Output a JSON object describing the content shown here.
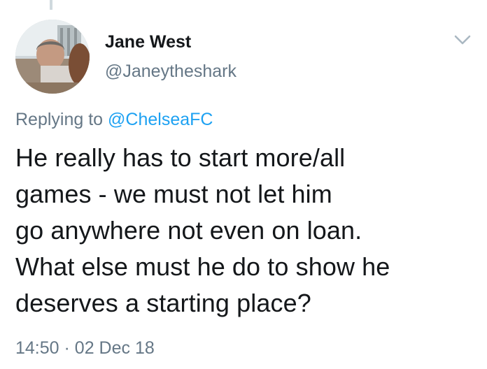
{
  "tweet": {
    "author": {
      "name": "Jane West",
      "handle": "@Janeytheshark",
      "avatar_icon": "user-avatar-photo"
    },
    "reply": {
      "prefix": "Replying to",
      "mention": "@ChelseaFC"
    },
    "text": "He really has to start more/all\ngames -  we must not let him\ngo anywhere not even on loan.\nWhat else must he do to show he\ndeserves a starting place?",
    "time": "14:50",
    "separator": "·",
    "date": "02 Dec 18",
    "menu_icon": "chevron-down-icon"
  },
  "colors": {
    "text": "#14171a",
    "secondary": "#657786",
    "link": "#1da1f2",
    "thread_line": "#cfd9de"
  }
}
